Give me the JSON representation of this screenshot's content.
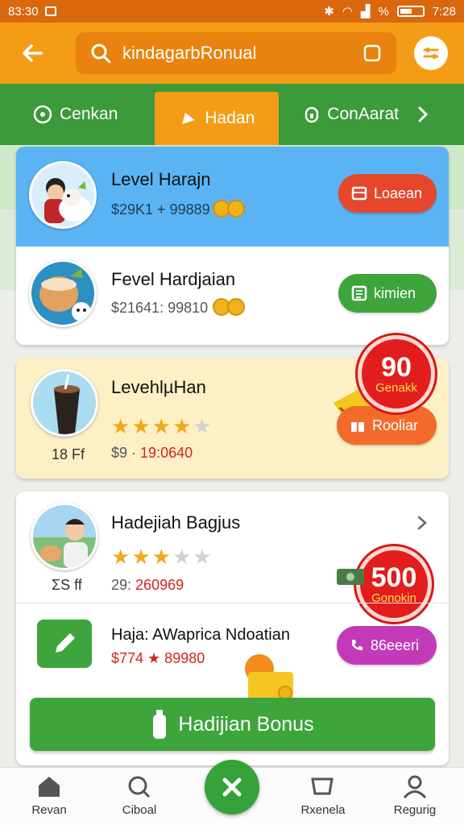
{
  "status": {
    "time": "83:30",
    "right_time": "7:28",
    "signal_text": "%"
  },
  "search": {
    "value": "kindagarbRonual"
  },
  "tabs": [
    {
      "label": "Cenkan"
    },
    {
      "label": "Hadan"
    },
    {
      "label": "ConAarat"
    }
  ],
  "cards": [
    {
      "title": "Level Harajn",
      "sub": "$29K1 + 99889",
      "button": "Loaean",
      "button_color": "#e4472c"
    },
    {
      "title": "Fevel Hardjaian",
      "sub": "$21641: 99810",
      "button": "kimien",
      "button_color": "#3da53b"
    },
    {
      "title": "LevehlµHan",
      "rating": 3.5,
      "left_caption": "18 Ff",
      "sub_prefix": "$9 ·",
      "sub_price": "19:0640",
      "button": "Rooliar",
      "button_color": "#f26b2b",
      "badge_num": "90",
      "badge_label": "Genakk"
    },
    {
      "title": "Hadejiah Bagjus",
      "rating": 3,
      "left_caption": "ΣS ff",
      "sub_prefix": "29:",
      "sub_price": "260969",
      "badge_num": "500",
      "badge_label": "Gonokin"
    },
    {
      "title": "Haja: AWaprica Ndoatian",
      "sub_price": "$774 ★ 89980",
      "button": "86eeeri",
      "button_color": "#c33ab9"
    }
  ],
  "bonus_button": "Hadijian Bonus",
  "nav": [
    {
      "label": "Revan"
    },
    {
      "label": "Ciboal"
    },
    {
      "label": "Rxenela"
    },
    {
      "label": "Regurig"
    }
  ],
  "colors": {
    "orange": "#f59c17",
    "green": "#3c9a3a",
    "red": "#e31d1d"
  }
}
